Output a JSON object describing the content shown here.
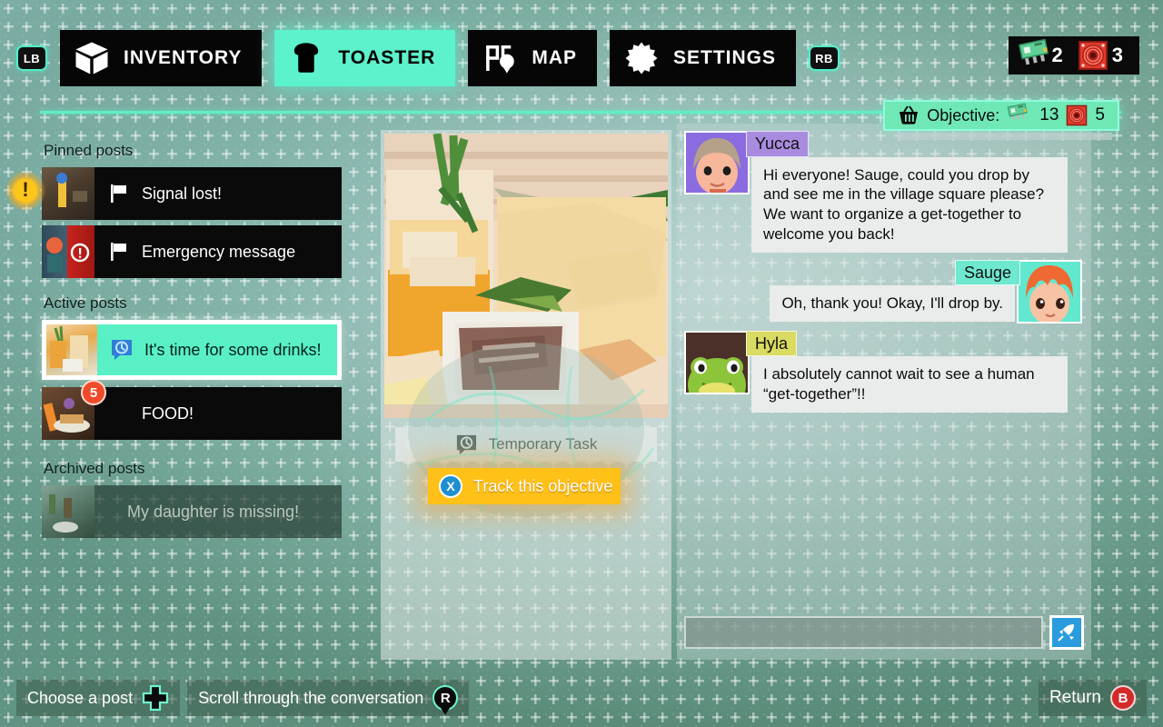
{
  "nav": {
    "left_shoulder": "LB",
    "right_shoulder": "RB",
    "tabs": [
      {
        "label": "INVENTORY",
        "icon": "box-icon",
        "active": false
      },
      {
        "label": "TOASTER",
        "icon": "toast-icon",
        "active": true
      },
      {
        "label": "MAP",
        "icon": "map-pin-icon",
        "active": false
      },
      {
        "label": "SETTINGS",
        "icon": "gear-icon",
        "active": false
      }
    ]
  },
  "currency": {
    "chip_icon": "circuit-chip-icon",
    "chip_count": "2",
    "fan_icon": "red-fan-icon",
    "fan_count": "3"
  },
  "objective": {
    "basket_icon": "basket-icon",
    "label": "Objective:",
    "chip_icon": "circuit-chip-icon",
    "chip_count": "13",
    "fan_icon": "red-fan-icon",
    "fan_count": "5"
  },
  "alert": {
    "icon": "exclamation-icon",
    "glyph": "!"
  },
  "posts": {
    "pinned_label": "Pinned posts",
    "active_label": "Active posts",
    "archived_label": "Archived posts",
    "pinned": [
      {
        "title": "Signal lost!",
        "icon": "flag-icon",
        "badge": ""
      },
      {
        "title": "Emergency message",
        "icon": "flag-icon",
        "badge": ""
      }
    ],
    "active": [
      {
        "title": "It's time for some drinks!",
        "icon": "clock-bubble-icon",
        "badge": "",
        "selected": true
      },
      {
        "title": "FOOD!",
        "icon": "",
        "badge": "5",
        "selected": false
      }
    ],
    "archived": [
      {
        "title": "My daughter is missing!",
        "icon": "",
        "badge": ""
      }
    ]
  },
  "center": {
    "task_type_icon": "clock-bubble-icon",
    "task_type": "Temporary Task",
    "track_button": {
      "key": "X",
      "label": "Track this objective"
    }
  },
  "conversation": {
    "messages": [
      {
        "speaker": "Yucca",
        "side": "left",
        "name_color": "#a98ce0",
        "avatar_bg": "#7c5fd4",
        "text": "Hi everyone! Sauge, could you drop by and see me in the village square please? We want to organize a get-together to welcome you back!"
      },
      {
        "speaker": "Sauge",
        "side": "right",
        "name_color": "#6fe8d0",
        "avatar_bg": "#62e8cf",
        "text": "Oh, thank you! Okay, I'll drop by."
      },
      {
        "speaker": "Hyla",
        "side": "left",
        "name_color": "#d9db62",
        "avatar_bg": "#4a3028",
        "text": "I absolutely cannot wait to see a human “get-together”!!"
      }
    ],
    "input_value": "",
    "input_placeholder": "",
    "send_icon": "send-rocket-icon"
  },
  "bottom": {
    "hints": [
      {
        "label": "Choose a post",
        "key": "dpad-icon"
      },
      {
        "label": "Scroll through the conversation",
        "key": "R"
      }
    ],
    "return": {
      "label": "Return",
      "key": "B"
    }
  },
  "colors": {
    "accent_teal": "#5cf2cb",
    "objective_green": "#6fe8b6",
    "track_amber": "#ffc117",
    "badge_red": "#f04a2a",
    "send_blue": "#2a9bdc"
  }
}
